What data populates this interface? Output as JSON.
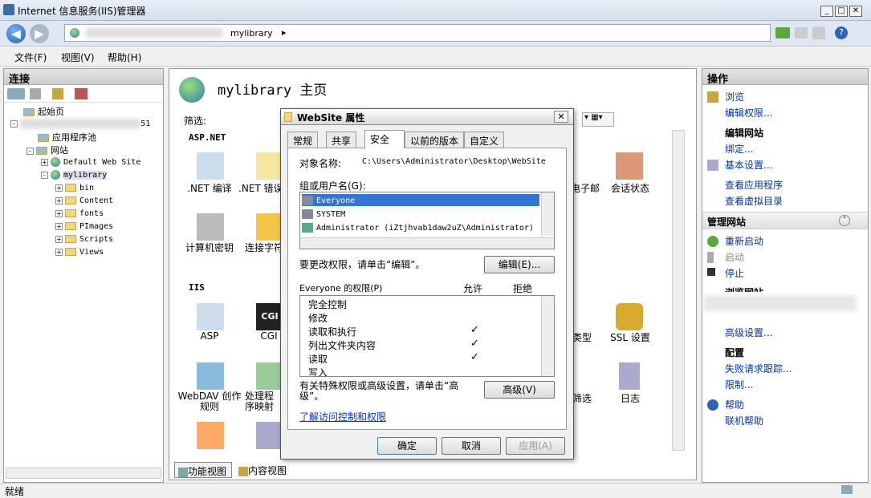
{
  "window": {
    "title": "Internet 信息服务(IIS)管理器"
  },
  "address": {
    "segment": "mylibrary",
    "arrow": "▸"
  },
  "menu": [
    "文件(F)",
    "视图(V)",
    "帮助(H)"
  ],
  "connections": {
    "header": "连接",
    "tree": [
      {
        "label": "起始页",
        "level": 1
      },
      {
        "label": "应用程序池",
        "level": 2
      },
      {
        "label": "网站",
        "level": 2
      },
      {
        "label": "Default Web Site",
        "level": 3
      },
      {
        "label": "mylibrary",
        "level": 3
      },
      {
        "label": "bin",
        "level": 4
      },
      {
        "label": "Content",
        "level": 4
      },
      {
        "label": "fonts",
        "level": 4
      },
      {
        "label": "PImages",
        "level": 4
      },
      {
        "label": "Scripts",
        "level": 4
      },
      {
        "label": "Views",
        "level": 4
      }
    ],
    "partial_suffix": "51"
  },
  "center": {
    "title": "mylibrary 主页",
    "filter_label": "筛选:",
    "section_aspnet": "ASP.NET",
    "section_iis": "IIS",
    "features": {
      "net_compile": ".NET 编译",
      "net_error": ".NET 错误",
      "machine_key": "计算机密钥",
      "connection_strings": "连接字符",
      "asp": "ASP",
      "cgi": "CGI",
      "webdav": "WebDAV 创作规则",
      "handlers": "处理程序映射",
      "email_partial": "电子邮",
      "session": "会话状态",
      "mime_partial": "类型",
      "ssl": "SSL 设置",
      "filter_partial": "筛选",
      "log": "日志"
    },
    "view_tabs": {
      "features": "功能视图",
      "content": "内容视图"
    }
  },
  "actions": {
    "header": "操作",
    "browse": "浏览",
    "edit_permissions": "编辑权限...",
    "edit_site_header": "编辑网站",
    "bindings": "绑定...",
    "basic_settings": "基本设置...",
    "view_apps": "查看应用程序",
    "view_vdirs": "查看虚拟目录",
    "manage_header": "管理网站",
    "restart": "重新启动",
    "start": "启动",
    "stop": "停止",
    "browse_site_partial": "浏览网站",
    "advanced_settings": "高级设置...",
    "config_header": "配置",
    "failed_tracing": "失败请求跟踪...",
    "limits": "限制...",
    "help": "帮助",
    "online_help": "联机帮助"
  },
  "status": {
    "text": "就绪"
  },
  "dialog": {
    "title": "WebSite 属性",
    "tabs": [
      "常规",
      "共享",
      "安全",
      "以前的版本",
      "自定义"
    ],
    "active_tab": "安全",
    "object_label": "对象名称:",
    "object_value": "C:\\Users\\Administrator\\Desktop\\WebSite",
    "groups_label": "组或用户名(G):",
    "users": [
      "Everyone",
      "SYSTEM",
      "Administrator (iZtjhvab1daw2uZ\\Administrator)"
    ],
    "change_hint": "要更改权限，请单击“编辑”。",
    "edit_button": "编辑(E)...",
    "perm_label": "Everyone 的权限(P)",
    "allow": "允许",
    "deny": "拒绝",
    "permissions": [
      {
        "name": "完全控制",
        "allow": ""
      },
      {
        "name": "修改",
        "allow": ""
      },
      {
        "name": "读取和执行",
        "allow": "✓"
      },
      {
        "name": "列出文件夹内容",
        "allow": "✓"
      },
      {
        "name": "读取",
        "allow": "✓"
      },
      {
        "name": "写入",
        "allow": ""
      }
    ],
    "special_hint": "有关特殊权限或高级设置，请单击“高级”。",
    "advanced_button": "高级(V)",
    "learn_link": "了解访问控制和权限",
    "ok": "确定",
    "cancel": "取消",
    "apply": "应用(A)"
  }
}
